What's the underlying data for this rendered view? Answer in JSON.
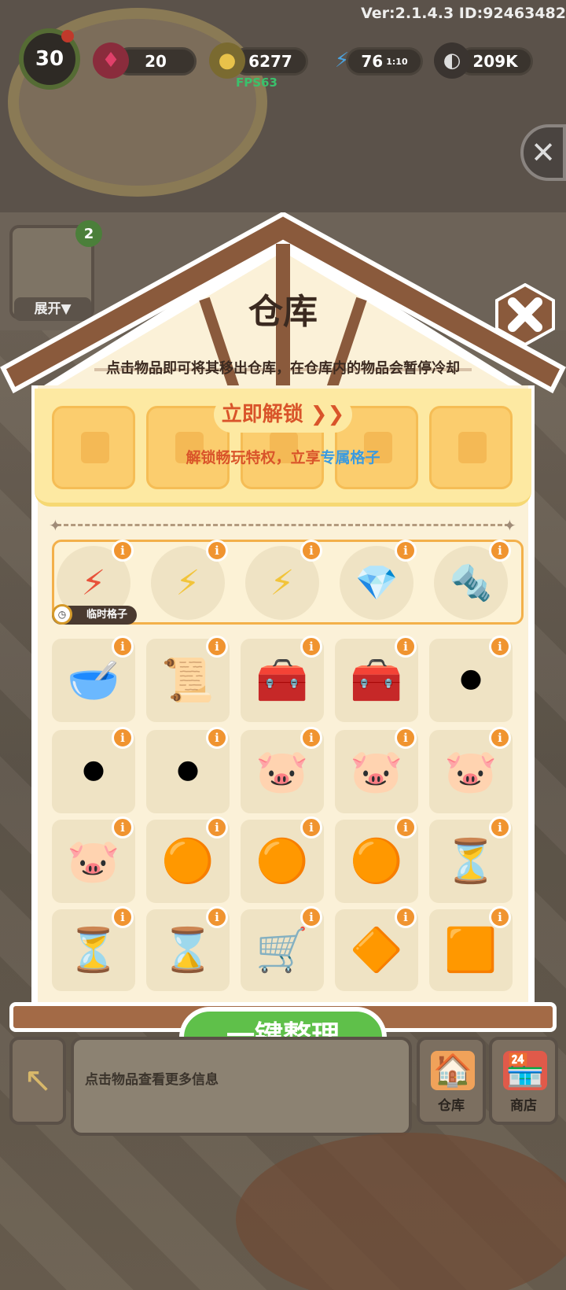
{
  "hud": {
    "version": "Ver:2.1.4.3 ID:92463482",
    "level": "30",
    "gems": "20",
    "coins": "6277",
    "energy": "76",
    "energy_timer": "1:10",
    "seeds": "209K",
    "fps": "FPS63"
  },
  "side": {
    "expand_label": "展开▼",
    "badge": "2"
  },
  "warehouse": {
    "title": "仓库",
    "subtitle": "点击物品即可将其移出仓库，在仓库内的物品会暂停冷却",
    "unlock_label": "立即解锁 ❯❯",
    "unlock_desc_a": "解锁畅玩特权，立享",
    "unlock_desc_b": "专属格子",
    "temp_label": "临时格子",
    "info_glyph": "i"
  },
  "temp_items": [
    {
      "icon": "red-energy-coin-icon",
      "glyph": "⚡"
    },
    {
      "icon": "yellow-energy-coin-icon",
      "glyph": "⚡"
    },
    {
      "icon": "yellow-energy-coin-icon",
      "glyph": "⚡"
    },
    {
      "icon": "pink-gems-icon",
      "glyph": "💎"
    },
    {
      "icon": "blue-screw-icon",
      "glyph": "🔩"
    }
  ],
  "grid_items": [
    {
      "icon": "green-bowl-icon",
      "glyph": "🥣"
    },
    {
      "icon": "stacked-papers-icon",
      "glyph": "📜"
    },
    {
      "icon": "yellow-toolbox-icon",
      "glyph": "🧰"
    },
    {
      "icon": "orange-toolbox-icon",
      "glyph": "🧰"
    },
    {
      "icon": "single-tire-icon",
      "glyph": "⚫"
    },
    {
      "icon": "two-tires-icon",
      "glyph": "⚫"
    },
    {
      "icon": "tire-stack-icon",
      "glyph": "⚫"
    },
    {
      "icon": "piggy-bank-icon",
      "glyph": "🐷"
    },
    {
      "icon": "piggy-bank-icon",
      "glyph": "🐷"
    },
    {
      "icon": "piggy-bank-icon",
      "glyph": "🐷"
    },
    {
      "icon": "piggy-bank-icon",
      "glyph": "🐷"
    },
    {
      "icon": "sand-orb-icon",
      "glyph": "🟠"
    },
    {
      "icon": "sand-orbs-cluster-icon",
      "glyph": "🟠"
    },
    {
      "icon": "large-sand-orb-icon",
      "glyph": "🟠"
    },
    {
      "icon": "small-hourglass-icon",
      "glyph": "⏳"
    },
    {
      "icon": "hourglass-icon",
      "glyph": "⏳"
    },
    {
      "icon": "blue-hourglass-icon",
      "glyph": "⌛"
    },
    {
      "icon": "wheelbarrow-icon",
      "glyph": "🛒"
    },
    {
      "icon": "amber-crystal-icon",
      "glyph": "🔶"
    },
    {
      "icon": "amber-stone-icon",
      "glyph": "🟧"
    }
  ],
  "bottom": {
    "sort_label": "一键整理",
    "hint": "点击物品查看更多信息",
    "warehouse_label": "仓库",
    "shop_label": "商店",
    "back_glyph": "↖",
    "warehouse_glyph": "🏠",
    "shop_glyph": "🏪"
  },
  "colors": {
    "accent": "#f09430",
    "green": "#5fc04a",
    "roof": "#8a5a3c",
    "panel": "#fbf1d8"
  }
}
